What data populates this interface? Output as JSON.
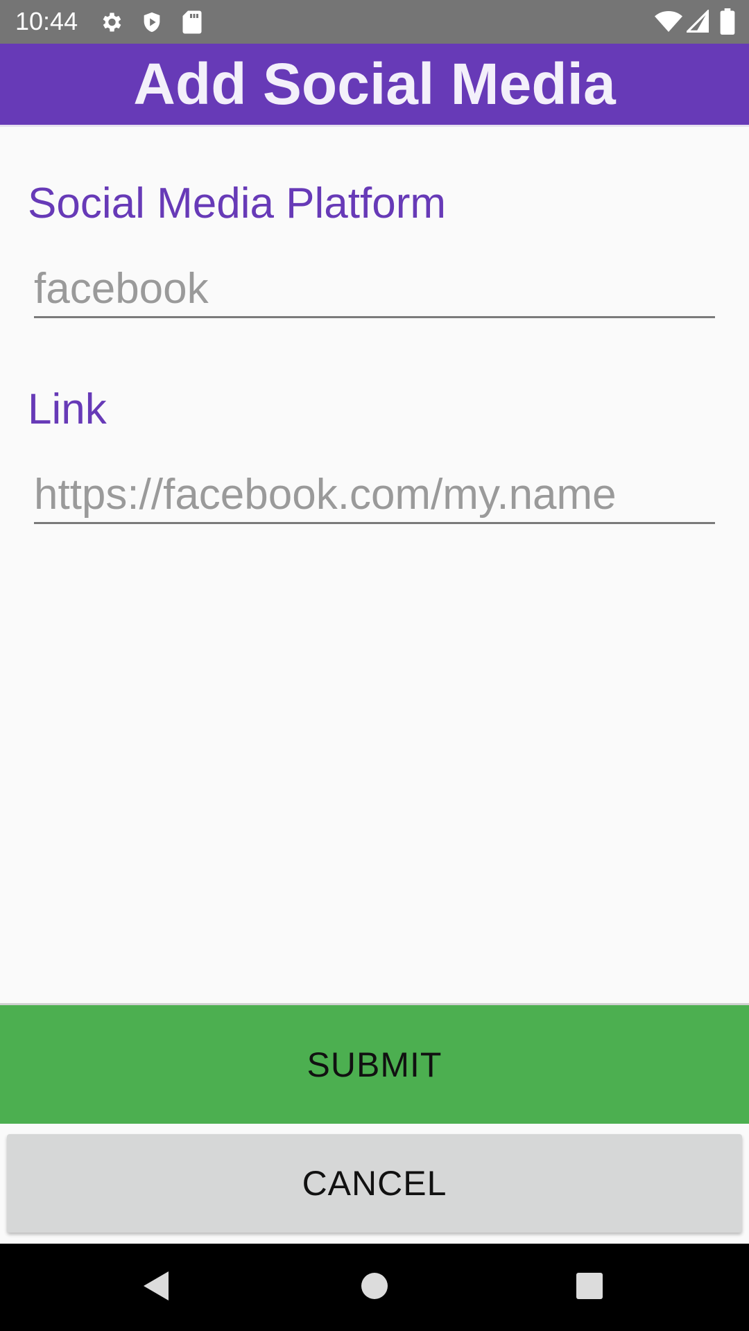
{
  "status_bar": {
    "time": "10:44",
    "icons_left": [
      "gear-icon",
      "shield-icon",
      "sd-card-icon"
    ],
    "icons_right": [
      "wifi-icon",
      "cell-signal-icon",
      "battery-icon"
    ]
  },
  "app_bar": {
    "title": "Add Social Media",
    "color": "#673ab7"
  },
  "form": {
    "platform": {
      "label": "Social Media Platform",
      "value": "",
      "placeholder": "facebook"
    },
    "link": {
      "label": "Link",
      "value": "",
      "placeholder": "https://facebook.com/my.name"
    }
  },
  "actions": {
    "submit_label": "SUBMIT",
    "submit_color": "#4caf50",
    "cancel_label": "CANCEL"
  },
  "nav_bar": {
    "buttons": [
      "back-icon",
      "home-icon",
      "recents-icon"
    ]
  }
}
